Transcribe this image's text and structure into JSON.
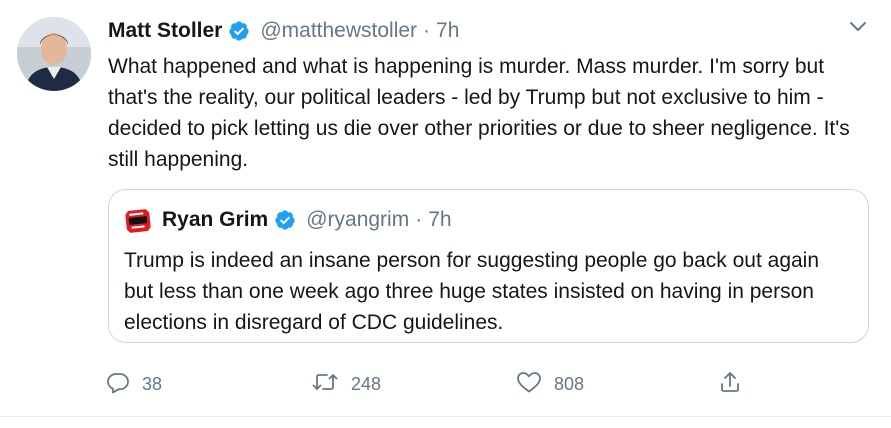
{
  "tweet": {
    "author": {
      "name": "Matt Stoller",
      "handle": "@matthewstoller",
      "time": "7h",
      "verified": true
    },
    "text": "What happened and what is happening is murder. Mass murder. I'm sorry but that's the reality, our political leaders - led by Trump but not exclusive to him - decided to pick letting us die over other priorities or due to sheer negligence. It's still happening.",
    "separator": "·",
    "quoted": {
      "author": {
        "name": "Ryan Grim",
        "handle": "@ryangrim",
        "time": "7h",
        "verified": true,
        "avatar_text": "WE'VE GOT PEOPLE"
      },
      "text": "Trump is indeed an insane person for suggesting people go back out again but less than one week ago three huge states insisted on having in person elections in disregard of CDC guidelines."
    },
    "actions": {
      "reply_count": "38",
      "retweet_count": "248",
      "like_count": "808"
    }
  },
  "colors": {
    "text": "#14171a",
    "secondary": "#657786",
    "verified_blue": "#1da1f2",
    "border": "#ccd6dd"
  },
  "icons": [
    "chevron-down-icon",
    "verified-icon",
    "reply-icon",
    "retweet-icon",
    "like-icon",
    "share-icon"
  ]
}
